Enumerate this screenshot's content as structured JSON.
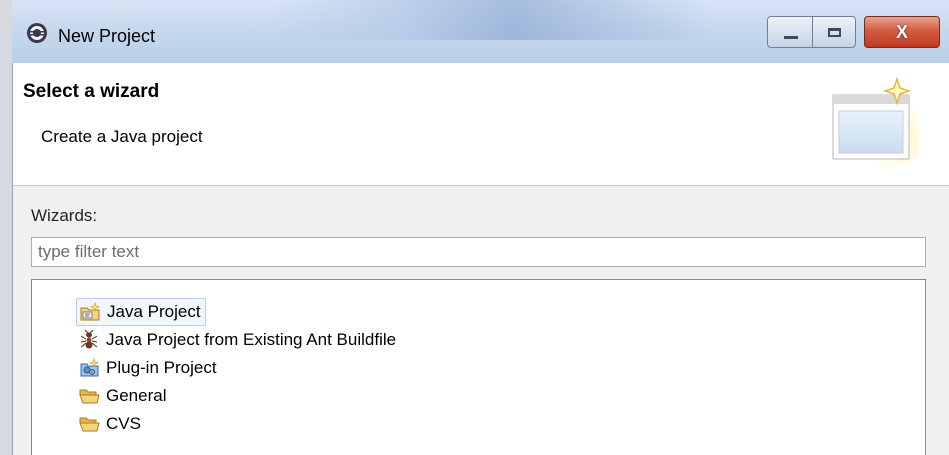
{
  "window": {
    "title": "New Project",
    "controls": {
      "minimize": "minimize",
      "maximize": "maximize",
      "close": "X"
    }
  },
  "banner": {
    "title": "Select a wizard",
    "description": "Create a Java project"
  },
  "wizards": {
    "label": "Wizards:",
    "filter_placeholder": "type filter text",
    "filter_value": "",
    "items": [
      {
        "label": "Java Project",
        "icon": "java-project-icon",
        "selected": true
      },
      {
        "label": "Java Project from Existing Ant Buildfile",
        "icon": "ant-buildfile-icon"
      },
      {
        "label": "Plug-in Project",
        "icon": "plugin-project-icon"
      },
      {
        "label": "General",
        "icon": "folder-icon"
      },
      {
        "label": "CVS",
        "icon": "folder-icon"
      }
    ]
  },
  "colors": {
    "title_bar": "#c6d8ee",
    "close_button": "#c8452d",
    "selection": "#f2f7fd",
    "folder": "#e8c25a"
  }
}
